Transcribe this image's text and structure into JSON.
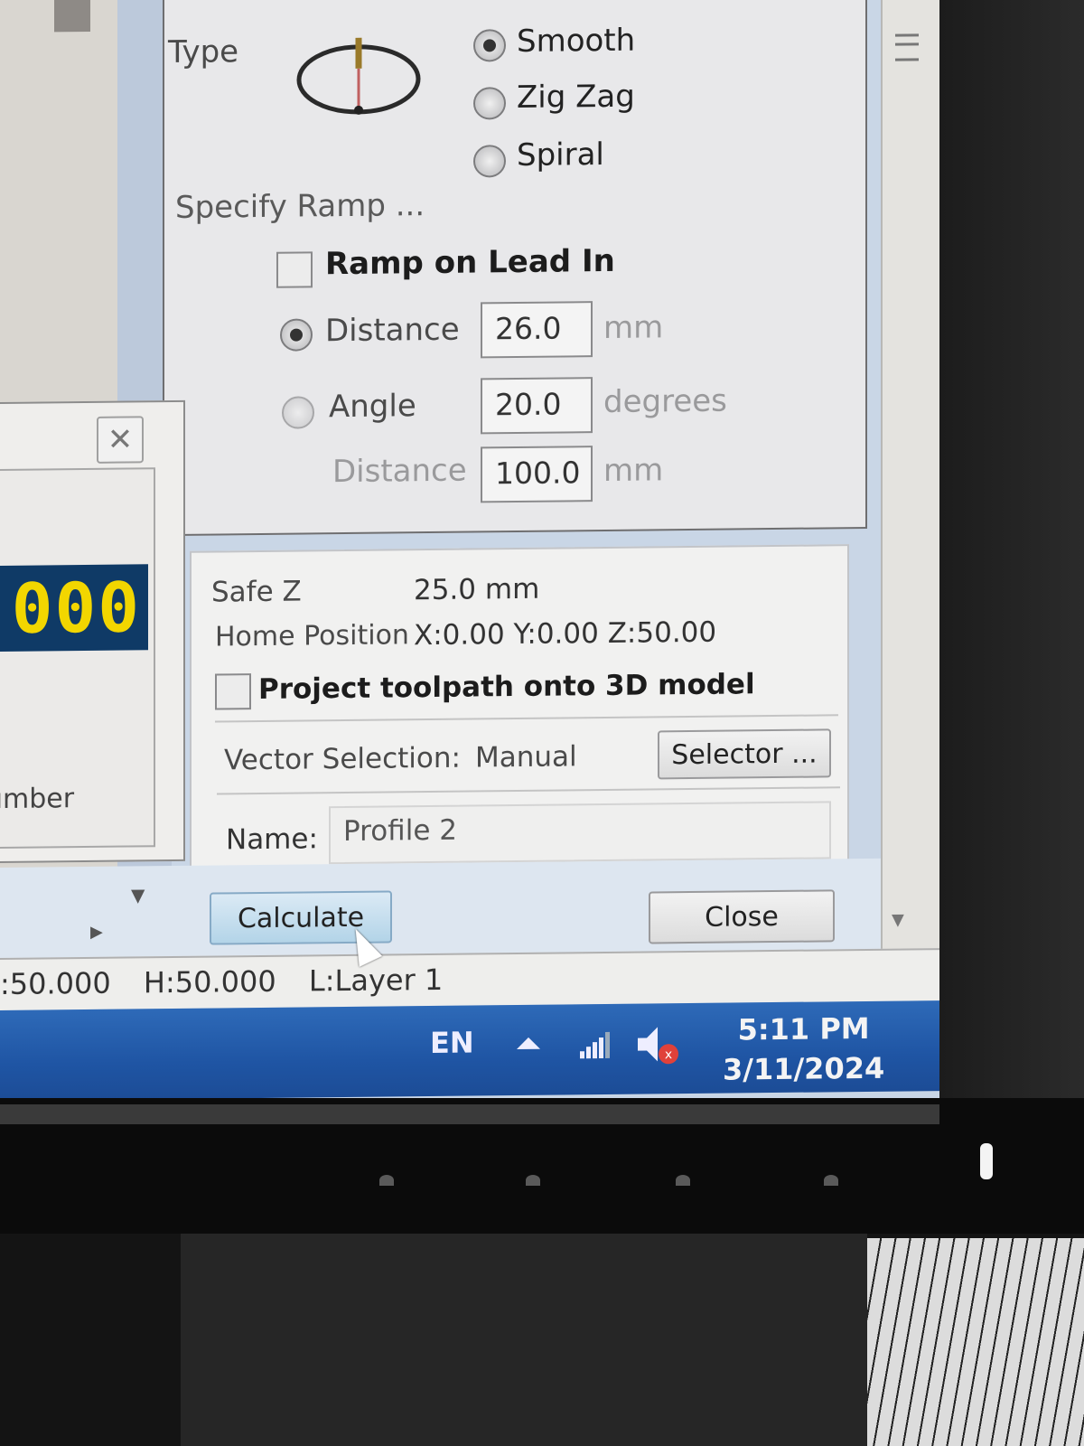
{
  "ramp_panel": {
    "type_label": "Type",
    "type_options": [
      {
        "label": "Smooth",
        "selected": true
      },
      {
        "label": "Zig Zag",
        "selected": false
      },
      {
        "label": "Spiral",
        "selected": false
      }
    ],
    "specify_label": "Specify Ramp ...",
    "ramp_on_lead_in": {
      "label": "Ramp on Lead In",
      "checked": false
    },
    "distance": {
      "label": "Distance",
      "value": "26.0",
      "unit": "mm",
      "selected": true
    },
    "angle": {
      "label": "Angle",
      "value": "20.0",
      "unit": "degrees",
      "selected": false
    },
    "angle_distance": {
      "label": "Distance",
      "value": "100.0",
      "unit": "mm"
    }
  },
  "settings": {
    "safe_z_label": "Safe Z",
    "safe_z_value": "25.0 mm",
    "home_label": "Home Position",
    "home_value": "X:0.00 Y:0.00 Z:50.00",
    "project_label": "Project toolpath onto 3D model",
    "project_checked": false,
    "vector_label": "Vector Selection:",
    "vector_value": "Manual",
    "selector_button": "Selector ...",
    "name_label": "Name:",
    "name_value": "Profile 2"
  },
  "buttons": {
    "calculate": "Calculate",
    "close": "Close"
  },
  "small_dialog": {
    "readout": "000",
    "partial_label": "umber",
    "close_icon": "close-x"
  },
  "status_bar": {
    "w": ":50.000",
    "h": "H:50.000",
    "layer": "L:Layer 1"
  },
  "taskbar": {
    "language": "EN",
    "time": "5:11 PM",
    "date": "3/11/2024",
    "icons": [
      "show-hidden-icons",
      "network-signal-icon",
      "volume-muted-icon"
    ],
    "accent": "#1f55a4"
  },
  "colors": {
    "readout_bg": "#0f3a66",
    "readout_fg": "#f2d600",
    "muted_badge": "#e0413a"
  }
}
